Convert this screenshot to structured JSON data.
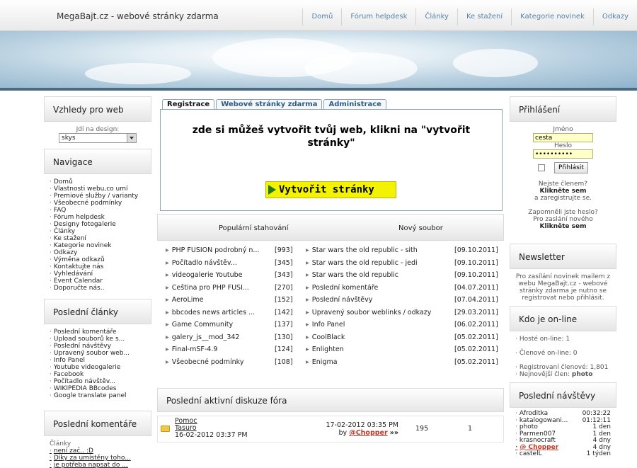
{
  "header": {
    "site_title": "MegaBajt.cz - webové stránky zdarma",
    "nav": [
      "Domů",
      "Fórum helpdesk",
      "Články",
      "Ke stažení",
      "Kategorie novinek",
      "Odkazy"
    ]
  },
  "left": {
    "designs": {
      "title": "Vzhledy pro web",
      "label": "Jdi na design:",
      "selected": "skys"
    },
    "navigation": {
      "title": "Navigace",
      "items": [
        "Domů",
        "Vlastnosti webu,co umí",
        "Premiové služby / varianty",
        "Všeobecné podmínky",
        "FAQ",
        "Fórum helpdesk",
        "Designy fotogalerie",
        "Články",
        "Ke stažení",
        "Kategorie novinek",
        "Odkazy",
        "Výměna odkazů",
        "Kontaktujte nás",
        "Vyhledávání",
        "Event Calendar",
        "Doporučte nás.."
      ]
    },
    "articles": {
      "title": "Poslední články",
      "items": [
        "Poslední komentáře",
        "Upload souborů ke s...",
        "Poslední návštěvy",
        "Upravený soubor web...",
        "Info Panel",
        "Youtube videogalerie",
        "Facebook",
        "Počítadlo návštěv...",
        "WIKIPEDIA BBcodes",
        "Google translate panel"
      ]
    },
    "comments": {
      "title": "Poslední komentáře",
      "category": "Články",
      "items": [
        "není zač.. :D",
        "Díky za umístěny toho...",
        "je potřeba napsat do ..."
      ]
    }
  },
  "tabs": [
    "Registrace",
    "Webové stránky zdarma",
    "Administrace"
  ],
  "promo": {
    "text": "zde si můžeš vytvořit tvůj web, klikni na \"vytvořit stránky\"",
    "button": "Vytvořit stránky"
  },
  "stats": {
    "col1_title": "Populární stahování",
    "col2_title": "Nový soubor",
    "popular": [
      {
        "name": "PHP FUSION podrobný n...",
        "count": "[993]"
      },
      {
        "name": "Počítadlo návštěv...",
        "count": "[345]"
      },
      {
        "name": "videogalerie Youtube",
        "count": "[343]"
      },
      {
        "name": "Čeština pro PHP FUSI...",
        "count": "[270]"
      },
      {
        "name": "AeroLime",
        "count": "[152]"
      },
      {
        "name": "bbcodes news articles ...",
        "count": "[142]"
      },
      {
        "name": "Game Community",
        "count": "[137]"
      },
      {
        "name": "galery_js__mod_342",
        "count": "[130]"
      },
      {
        "name": "Final-mSF-4.9",
        "count": "[124]"
      },
      {
        "name": "Všeobecné podmínky",
        "count": "[108]"
      }
    ],
    "newest": [
      {
        "name": "Star wars the old republic - sith",
        "date": "[09.10.2011]"
      },
      {
        "name": "Star wars the old republic - jedi",
        "date": "[09.10.2011]"
      },
      {
        "name": "Star wars the old republic",
        "date": "[09.10.2011]"
      },
      {
        "name": "Poslední komentáře",
        "date": "[04.07.2011]"
      },
      {
        "name": "Poslední návštěvy",
        "date": "[07.04.2011]"
      },
      {
        "name": "Upravený soubor weblinks / odkazy",
        "date": "[29.03.2011]"
      },
      {
        "name": "Info Panel",
        "date": "[06.02.2011]"
      },
      {
        "name": "CoolBlack",
        "date": "[05.02.2011]"
      },
      {
        "name": "Enlighten",
        "date": "[05.02.2011]"
      },
      {
        "name": "Enigma",
        "date": "[05.02.2011]"
      }
    ]
  },
  "forum": {
    "title": "Poslední aktivní diskuze fóra",
    "row": {
      "topic": "Pomoc",
      "author": "Tasuro",
      "created": "16-02-2012 03:37 PM",
      "last_post": "17-02-2012 03:35 PM",
      "by_label": "by",
      "last_user": "@Chopper",
      "views": "195",
      "replies": "1"
    }
  },
  "right": {
    "login": {
      "title": "Přihlášení",
      "name_label": "Jméno",
      "name_value": "cesta",
      "password_label": "Heslo",
      "password_value": "••••••••••",
      "submit": "Přihlásit",
      "not_member": "Nejste členem?",
      "click_here": "Klikněte sem",
      "register": "a zaregistrujte se.",
      "forgot": "Zapomněli jste heslo?",
      "send_new": "Pro zaslání nového",
      "click_here2": "Klikněte sem"
    },
    "newsletter": {
      "title": "Newsletter",
      "text": "Pro zasílání novinek mailem z webu MegaBajt.cz - webové stránky zdarma je nutno se registrovat nebo přihlásit."
    },
    "online": {
      "title": "Kdo je on-line",
      "guests": "Hosté on-line: 1",
      "members": "Členové on-line: 0",
      "registered": "Registrovaní členové: 1,801",
      "newest_label": "Nejnovější člen:",
      "newest_member": "photo"
    },
    "visits": {
      "title": "Poslední návštěvy",
      "items": [
        {
          "name": "Afroditka",
          "time": "00:32:22"
        },
        {
          "name": "katalogowani...",
          "time": "01:12:11"
        },
        {
          "name": "photo",
          "time": "1 den"
        },
        {
          "name": "Parmen007",
          "time": "1 den"
        },
        {
          "name": "krasnocraft",
          "time": "4 dny"
        },
        {
          "name": "@ Chopper",
          "time": "4 dny"
        },
        {
          "name": "castelL",
          "time": "1 týden"
        }
      ]
    }
  }
}
